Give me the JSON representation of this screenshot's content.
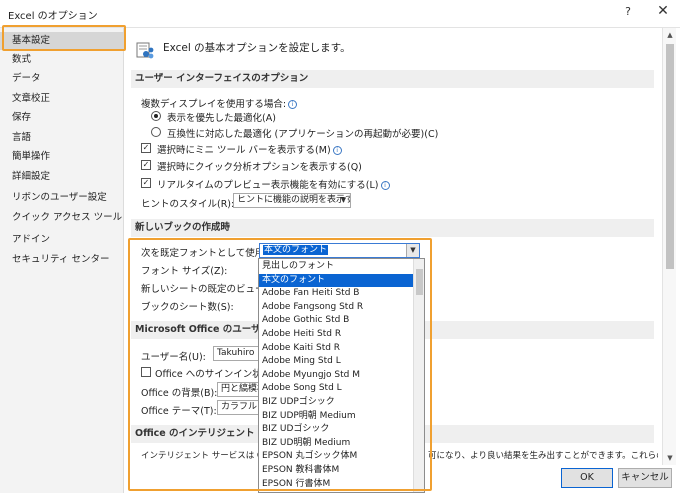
{
  "window": {
    "title": "Excel のオプション",
    "help": "?",
    "close": "✕"
  },
  "nav": {
    "items": [
      {
        "label": "基本設定"
      },
      {
        "label": "数式"
      },
      {
        "label": "データ"
      },
      {
        "label": "文章校正"
      },
      {
        "label": "保存"
      },
      {
        "label": "言語"
      },
      {
        "label": "簡単操作"
      },
      {
        "label": "詳細設定"
      },
      {
        "label": "リボンのユーザー設定"
      },
      {
        "label": "クイック アクセス ツール バー"
      },
      {
        "label": "アドイン"
      },
      {
        "label": "セキュリティ センター"
      }
    ]
  },
  "header": {
    "text": "Excel の基本オプションを設定します。"
  },
  "ui_section": {
    "title": "ユーザー インターフェイスのオプション",
    "multi_display_label": "複数ディスプレイを使用する場合:",
    "radio1": "表示を優先した最適化(A)",
    "radio2": "互換性に対応した最適化 (アプリケーションの再起動が必要)(C)",
    "check1": "選択時にミニ ツール バーを表示する(M)",
    "check2": "選択時にクイック分析オプションを表示する(Q)",
    "check3": "リアルタイムのプレビュー表示機能を有効にする(L)",
    "tooltip_label": "ヒントのスタイル(R):",
    "tooltip_value": "ヒントに機能の説明を表示する"
  },
  "new_book_section": {
    "title": "新しいブックの作成時",
    "font_label": "次を既定フォントとして使用(N):",
    "font_value": "本文のフォント",
    "font_size_label": "フォント サイズ(Z):",
    "default_view_label": "新しいシートの既定のビュー(V):",
    "sheet_count_label": "ブックのシート数(S):"
  },
  "office_section": {
    "title": "Microsoft Office のユーザー設",
    "username_label": "ユーザー名(U):",
    "username_value": "Takuhiro",
    "signin_label": "Office へのサインイン状態に",
    "bg_label": "Office の背景(B):",
    "bg_value": "円と縞模様",
    "theme_label": "Office テーマ(T):",
    "theme_value": "カラフル"
  },
  "intel_section": {
    "title": "Office のインテリジェント サービ",
    "desc_left": "インテリジェント サービスは Office",
    "desc_right": "可になり、より良い結果を生み出すことができます。これらのサービスを"
  },
  "font_list": {
    "items": [
      "見出しのフォント",
      "本文のフォント",
      "Adobe Fan Heiti Std B",
      "Adobe Fangsong Std R",
      "Adobe Gothic Std B",
      "Adobe Heiti Std R",
      "Adobe Kaiti Std R",
      "Adobe Ming Std L",
      "Adobe Myungjo Std M",
      "Adobe Song Std L",
      "BIZ UDPゴシック",
      "BIZ UDP明朝 Medium",
      "BIZ UDゴシック",
      "BIZ UD明朝 Medium",
      "EPSON 丸ゴシック体M",
      "EPSON 教科書体M",
      "EPSON 行書体M"
    ],
    "selected_index": 1
  },
  "footer": {
    "ok": "OK",
    "cancel": "キャンセル"
  },
  "colors": {
    "accent": "#0a64d2",
    "highlight": "#f0a030"
  }
}
